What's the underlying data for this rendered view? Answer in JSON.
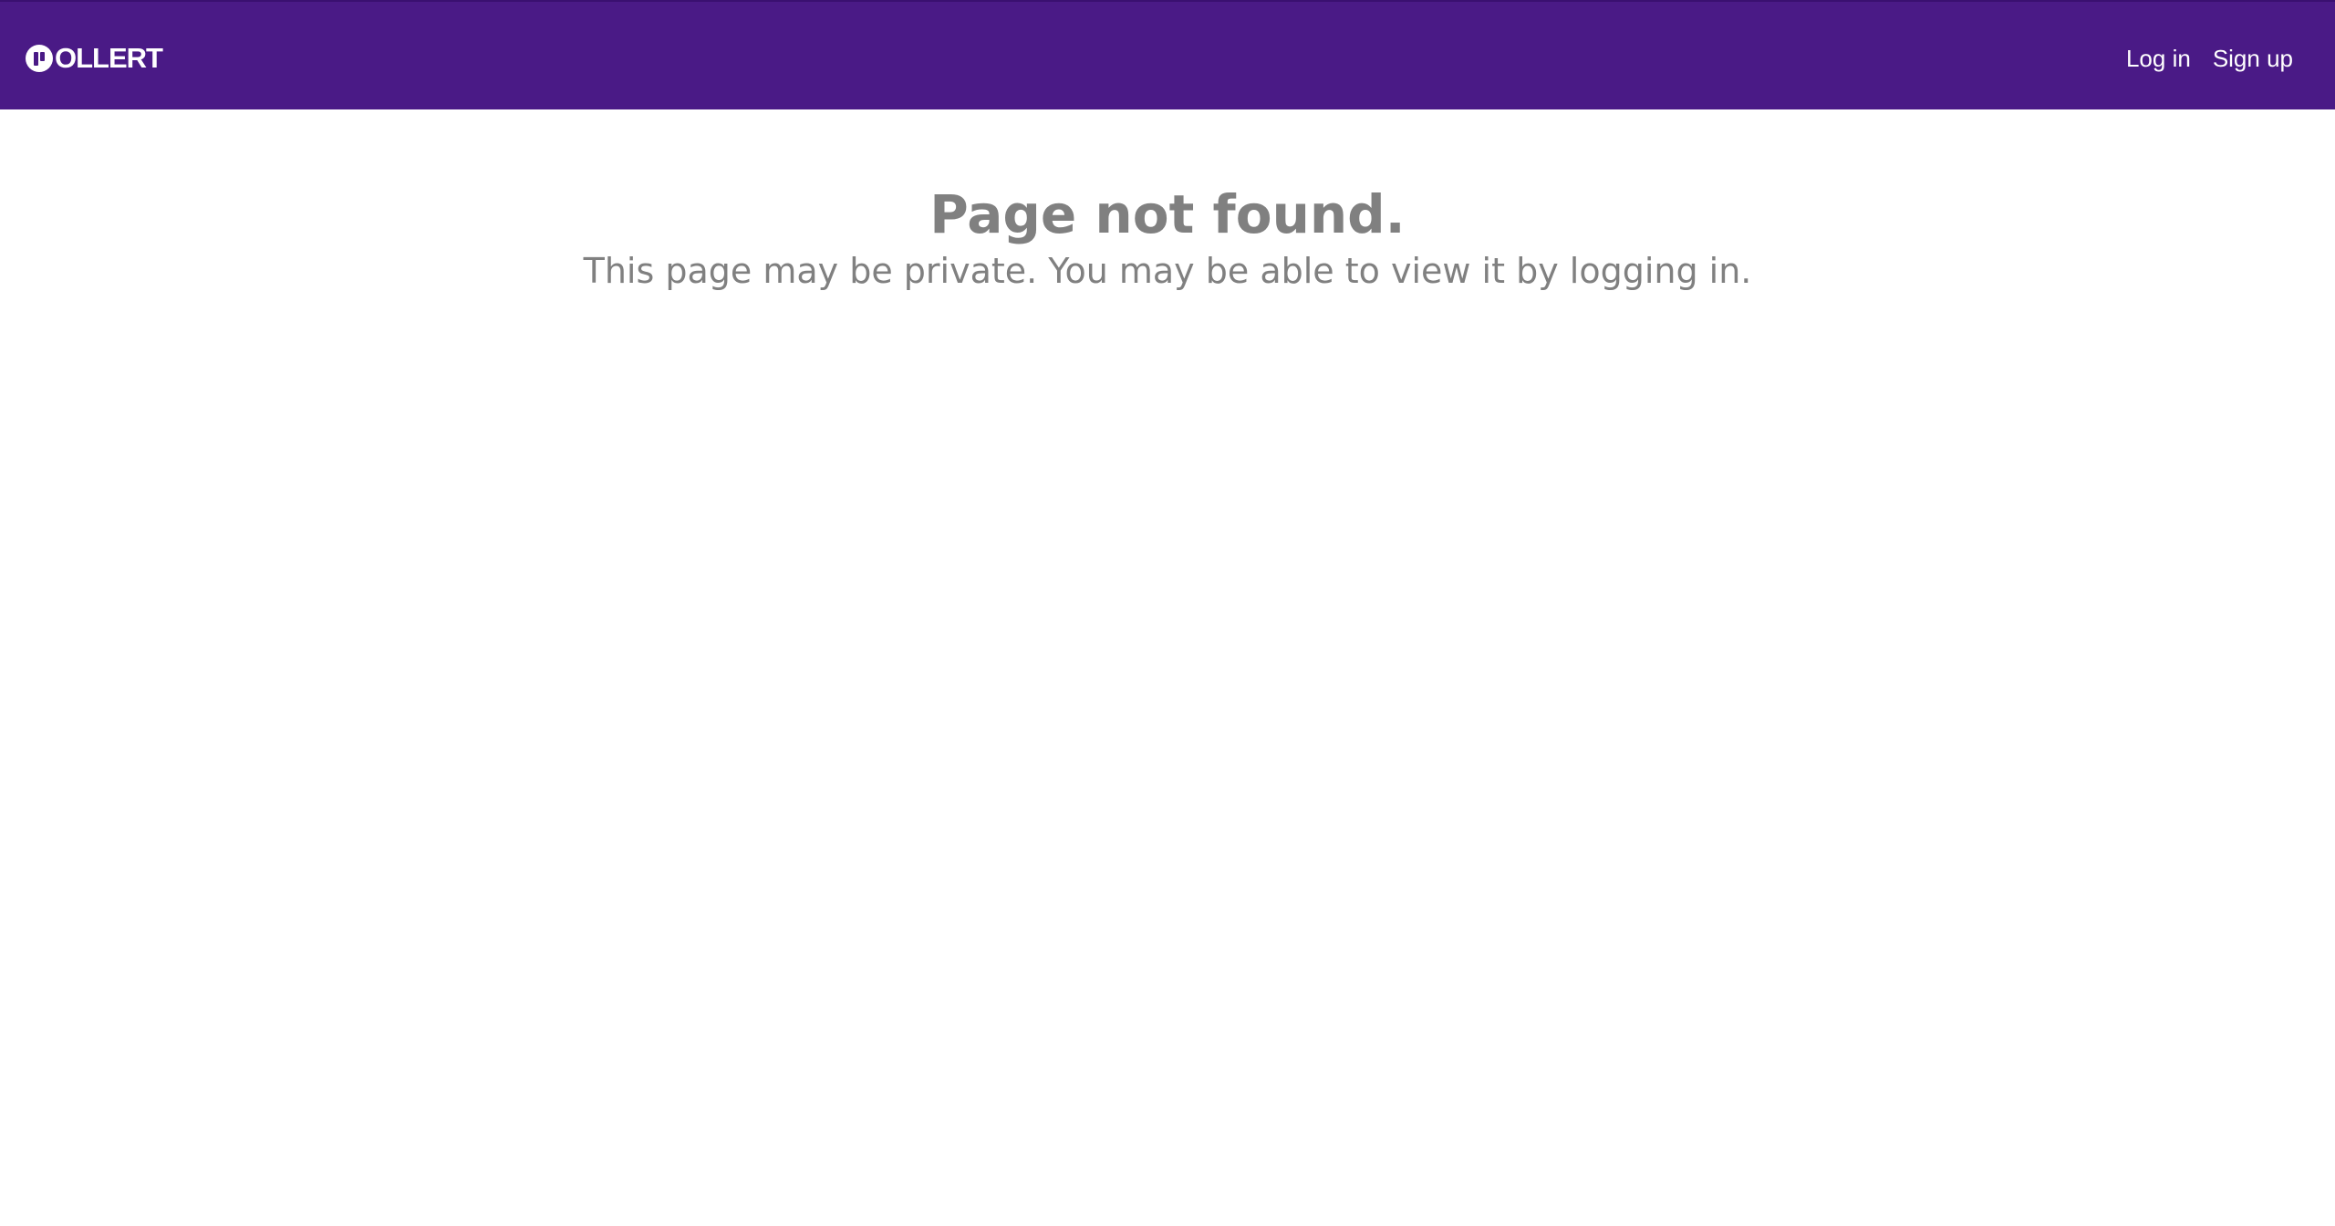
{
  "header": {
    "logo_text": "OLLERT",
    "logo_icon": "pollert-logo-icon",
    "background_color": "#4a1a86",
    "nav": {
      "login_label": "Log in",
      "signup_label": "Sign up"
    }
  },
  "main": {
    "title": "Page not found.",
    "message": "This page may be private. You may be able to view it by logging in.",
    "text_color": "#808080"
  }
}
